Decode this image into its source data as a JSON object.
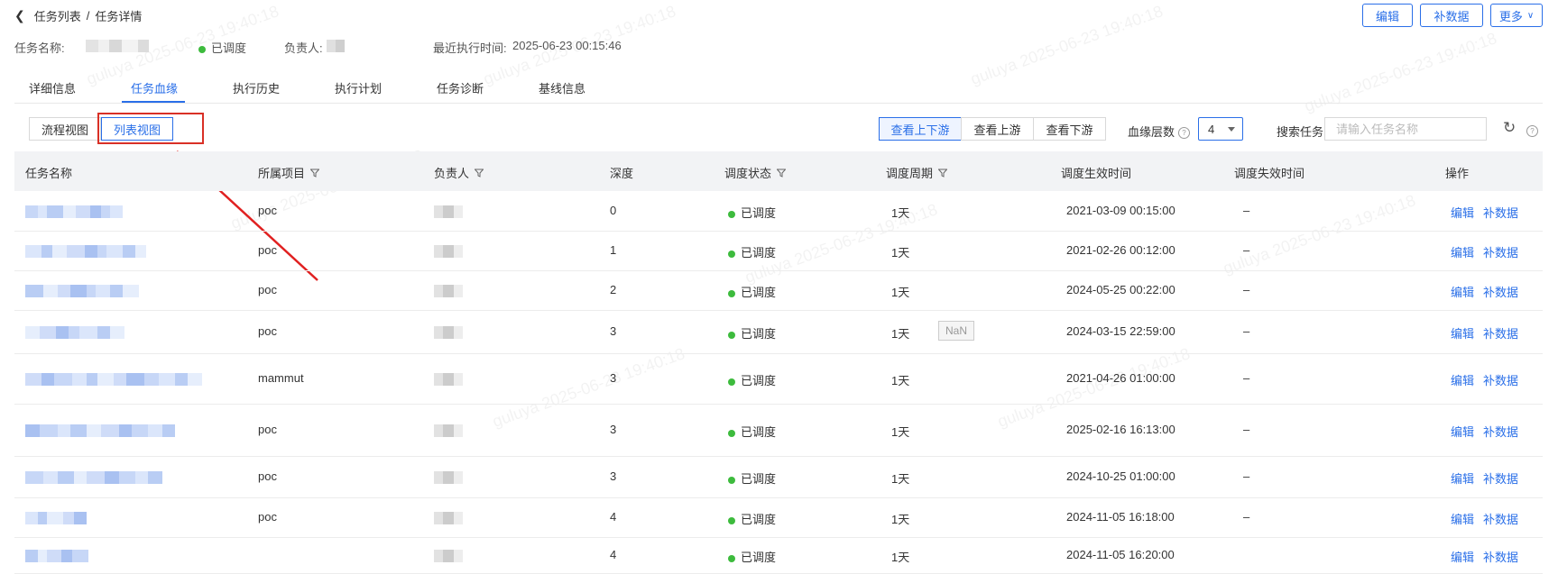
{
  "breadcrumb": {
    "parent": "任务列表",
    "sep": "/",
    "current": "任务详情"
  },
  "header_actions": {
    "edit": "编辑",
    "backfill": "补数据",
    "more": "更多"
  },
  "info": {
    "name_label": "任务名称:",
    "status": "已调度",
    "owner_label": "负责人:",
    "last_run_label": "最近执行时间:",
    "last_run_value": "2025-06-23 00:15:46"
  },
  "tabs": [
    "详细信息",
    "任务血缘",
    "执行历史",
    "执行计划",
    "任务诊断",
    "基线信息"
  ],
  "active_tab": "任务血缘",
  "view_buttons": {
    "flow": "流程视图",
    "list": "列表视图"
  },
  "lineage_buttons": {
    "both": "查看上下游",
    "up": "查看上游",
    "down": "查看下游"
  },
  "depth": {
    "label": "血缘层数",
    "value": "4"
  },
  "search": {
    "label": "搜索任务",
    "placeholder": "请输入任务名称"
  },
  "watermark": "guluya 2025-06-23 19:40:18",
  "table": {
    "columns": [
      "任务名称",
      "所属项目",
      "负责人",
      "深度",
      "调度状态",
      "调度周期",
      "调度生效时间",
      "调度失效时间",
      "操作"
    ],
    "rows": [
      {
        "project": "poc",
        "depth": "0",
        "status": "已调度",
        "period": "1天",
        "start": "2021-03-09 00:15:00",
        "end": "–",
        "edit": "编辑",
        "backfill": "补数据"
      },
      {
        "project": "poc",
        "depth": "1",
        "status": "已调度",
        "period": "1天",
        "start": "2021-02-26 00:12:00",
        "end": "–",
        "edit": "编辑",
        "backfill": "补数据"
      },
      {
        "project": "poc",
        "depth": "2",
        "status": "已调度",
        "period": "1天",
        "start": "2024-05-25 00:22:00",
        "end": "–",
        "edit": "编辑",
        "backfill": "补数据"
      },
      {
        "project": "poc",
        "depth": "3",
        "status": "已调度",
        "period": "1天",
        "start": "2024-03-15 22:59:00",
        "end": "–",
        "edit": "编辑",
        "backfill": "补数据"
      },
      {
        "project": "mammut",
        "depth": "3",
        "status": "已调度",
        "period": "1天",
        "start": "2021-04-26 01:00:00",
        "end": "–",
        "edit": "编辑",
        "backfill": "补数据"
      },
      {
        "project": "poc",
        "depth": "3",
        "status": "已调度",
        "period": "1天",
        "start": "2025-02-16 16:13:00",
        "end": "–",
        "edit": "编辑",
        "backfill": "补数据"
      },
      {
        "project": "poc",
        "depth": "3",
        "status": "已调度",
        "period": "1天",
        "start": "2024-10-25 01:00:00",
        "end": "–",
        "edit": "编辑",
        "backfill": "补数据"
      },
      {
        "project": "poc",
        "depth": "4",
        "status": "已调度",
        "period": "1天",
        "start": "2024-11-05 16:18:00",
        "end": "–",
        "edit": "编辑",
        "backfill": "补数据"
      },
      {
        "project": "",
        "depth": "4",
        "status": "已调度",
        "period": "1天",
        "start": "2024-11-05 16:20:00",
        "end": "",
        "edit": "编辑",
        "backfill": "补数据"
      }
    ]
  },
  "nan_badge": "NaN"
}
